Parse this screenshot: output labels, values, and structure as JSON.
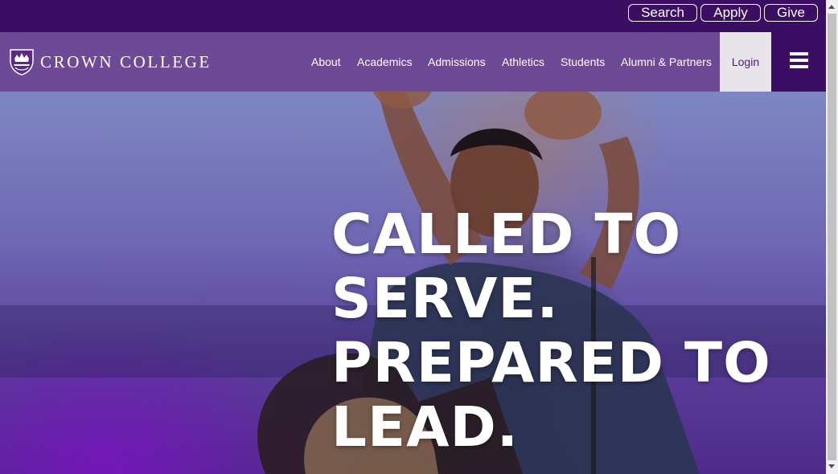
{
  "utility": {
    "search_label": "Search",
    "apply_label": "Apply",
    "give_label": "Give"
  },
  "header": {
    "logo_text": "CROWN COLLEGE",
    "logo_icon": "crown-shield-icon",
    "nav": [
      "About",
      "Academics",
      "Admissions",
      "Athletics",
      "Students",
      "Alumni & Partners"
    ],
    "login_label": "Login",
    "menu_icon": "hamburger-menu-icon"
  },
  "hero": {
    "headline_lines": [
      "CALLED TO",
      "SERVE.",
      "PREPARED TO",
      "LEAD."
    ]
  },
  "colors": {
    "brand_purple": "#3b0e63",
    "header_overlay": "#8260aa",
    "login_bg": "#e7e4ea",
    "text_light": "#ffffff"
  }
}
